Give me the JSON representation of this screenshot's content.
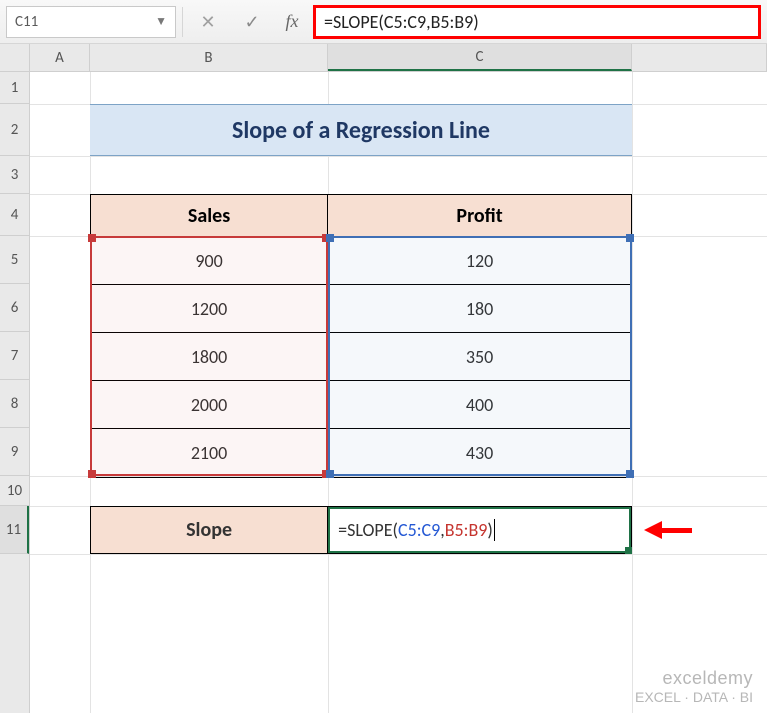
{
  "name_box": {
    "value": "C11"
  },
  "formula_bar": {
    "prefix": "=SLOPE(",
    "arg1": "C5:C9",
    "sep": ",",
    "arg2": "B5:B9",
    "suffix": ")"
  },
  "columns": {
    "A": "A",
    "B": "B",
    "C": "C",
    "D": " "
  },
  "rows": [
    "1",
    "2",
    "3",
    "4",
    "5",
    "6",
    "7",
    "8",
    "9",
    "10",
    "11"
  ],
  "title": "Slope of a Regression Line",
  "table": {
    "headers": {
      "B": "Sales",
      "C": "Profit"
    },
    "rows": [
      {
        "sales": "900",
        "profit": "120"
      },
      {
        "sales": "1200",
        "profit": "180"
      },
      {
        "sales": "1800",
        "profit": "350"
      },
      {
        "sales": "2000",
        "profit": "400"
      },
      {
        "sales": "2100",
        "profit": "430"
      }
    ]
  },
  "slope": {
    "label": "Slope",
    "formula_prefix": "=SLOPE(",
    "arg1": "C5:C9",
    "sep": ",",
    "arg2": "B5:B9",
    "suffix": ")"
  },
  "watermark": {
    "brand": "exceldemy",
    "tag": "EXCEL · DATA · BI"
  },
  "chart_data": {
    "type": "table",
    "title": "Slope of a Regression Line",
    "columns": [
      "Sales",
      "Profit"
    ],
    "rows": [
      [
        900,
        120
      ],
      [
        1200,
        180
      ],
      [
        1800,
        350
      ],
      [
        2000,
        400
      ],
      [
        2100,
        430
      ]
    ],
    "computed": {
      "label": "Slope",
      "formula": "=SLOPE(C5:C9,B5:B9)"
    }
  }
}
